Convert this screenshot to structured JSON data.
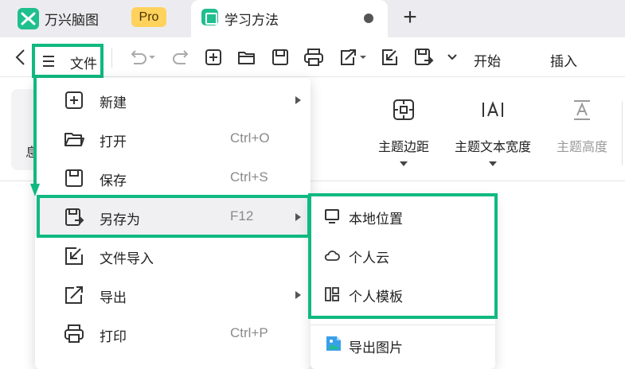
{
  "tabs": {
    "app_name": "万兴脑图",
    "pro_badge": "Pro",
    "document_title": "学习方法",
    "new_tab": "+"
  },
  "toolbar": {
    "file_label": "文件",
    "ribbon_tabs": [
      "开始",
      "插入"
    ],
    "icons": [
      "back-icon",
      "undo-icon",
      "redo-icon",
      "new-icon",
      "open-folder-icon",
      "save-icon",
      "print-icon",
      "export-icon",
      "import-icon",
      "save-as-icon",
      "more-chevron-icon"
    ]
  },
  "ribbon": {
    "left_fragment": "息",
    "groups": [
      {
        "label": "主题边距",
        "icon": "topic-margin-icon",
        "disabled": false
      },
      {
        "label": "主题文本宽度",
        "icon": "text-width-icon",
        "disabled": false
      },
      {
        "label": "主题高度",
        "icon": "topic-height-icon",
        "disabled": true
      }
    ]
  },
  "file_menu": {
    "items": [
      {
        "label": "新建",
        "shortcut": "",
        "submenu": true,
        "icon": "new-icon"
      },
      {
        "label": "打开",
        "shortcut": "Ctrl+O",
        "submenu": false,
        "icon": "open-folder-icon"
      },
      {
        "label": "保存",
        "shortcut": "Ctrl+S",
        "submenu": false,
        "icon": "save-icon"
      },
      {
        "label": "另存为",
        "shortcut": "F12",
        "submenu": true,
        "icon": "save-as-icon"
      },
      {
        "label": "文件导入",
        "shortcut": "",
        "submenu": false,
        "icon": "import-icon"
      },
      {
        "label": "导出",
        "shortcut": "",
        "submenu": true,
        "icon": "export-icon"
      },
      {
        "label": "打印",
        "shortcut": "Ctrl+P",
        "submenu": false,
        "icon": "print-icon"
      }
    ]
  },
  "save_as_submenu": {
    "items": [
      {
        "label": "本地位置",
        "icon": "monitor-icon"
      },
      {
        "label": "个人云",
        "icon": "cloud-icon"
      },
      {
        "label": "个人模板",
        "icon": "template-icon"
      }
    ],
    "extra_item": {
      "label": "导出图片",
      "icon": "image-icon"
    }
  },
  "colors": {
    "highlight": "#10b981",
    "brand": "#1fbf8f",
    "pro_badge": "#ffd25c"
  }
}
